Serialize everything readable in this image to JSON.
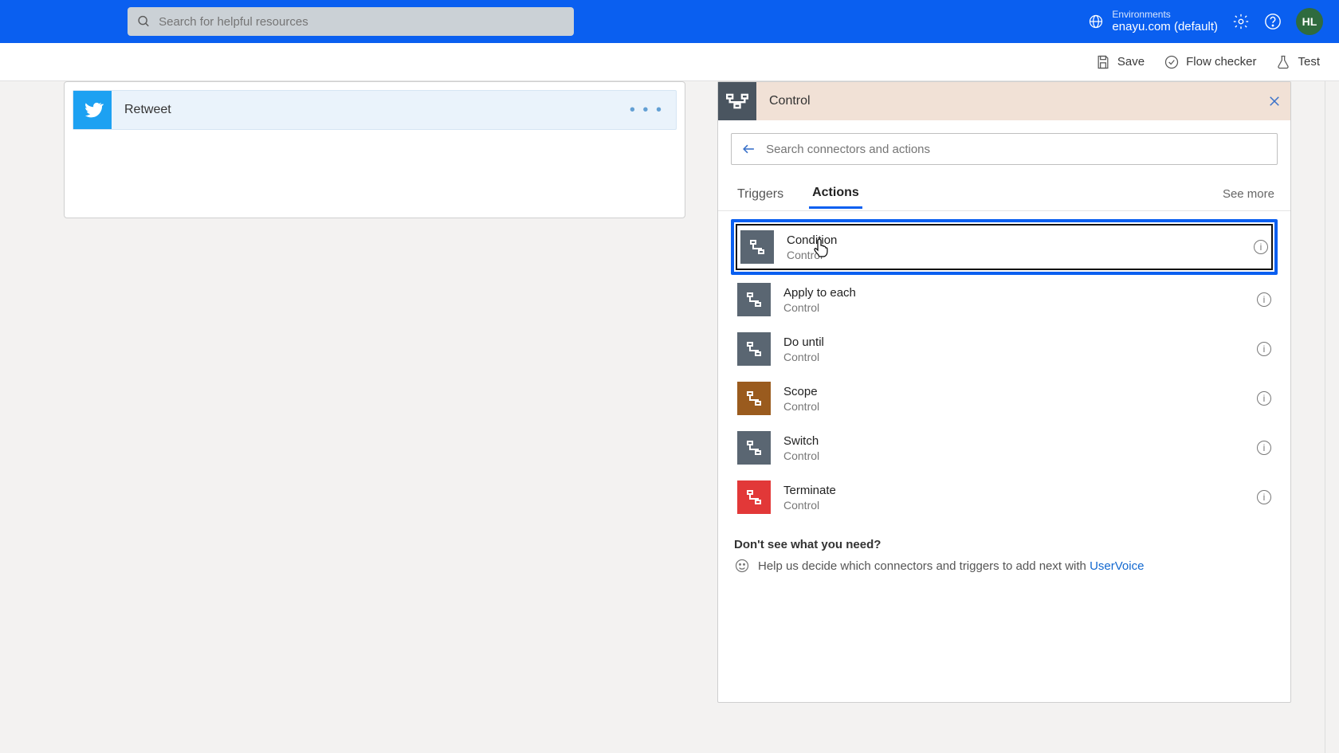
{
  "header": {
    "search_placeholder": "Search for helpful resources",
    "env_label": "Environments",
    "env_value": "enayu.com (default)",
    "avatar": "HL"
  },
  "commands": {
    "save": "Save",
    "flow_checker": "Flow checker",
    "test": "Test"
  },
  "flow": {
    "step_title": "Retweet"
  },
  "control": {
    "title": "Control",
    "search_placeholder": "Search connectors and actions",
    "tab_triggers": "Triggers",
    "tab_actions": "Actions",
    "see_more": "See more",
    "items": [
      {
        "name": "Condition",
        "category": "Control",
        "color": "gray",
        "selected": true
      },
      {
        "name": "Apply to each",
        "category": "Control",
        "color": "gray",
        "selected": false
      },
      {
        "name": "Do until",
        "category": "Control",
        "color": "gray",
        "selected": false
      },
      {
        "name": "Scope",
        "category": "Control",
        "color": "brown",
        "selected": false
      },
      {
        "name": "Switch",
        "category": "Control",
        "color": "gray",
        "selected": false
      },
      {
        "name": "Terminate",
        "category": "Control",
        "color": "red",
        "selected": false
      }
    ],
    "help_question": "Don't see what you need?",
    "help_text_prefix": "Help us decide which connectors and triggers to add next with ",
    "help_link": "UserVoice"
  }
}
